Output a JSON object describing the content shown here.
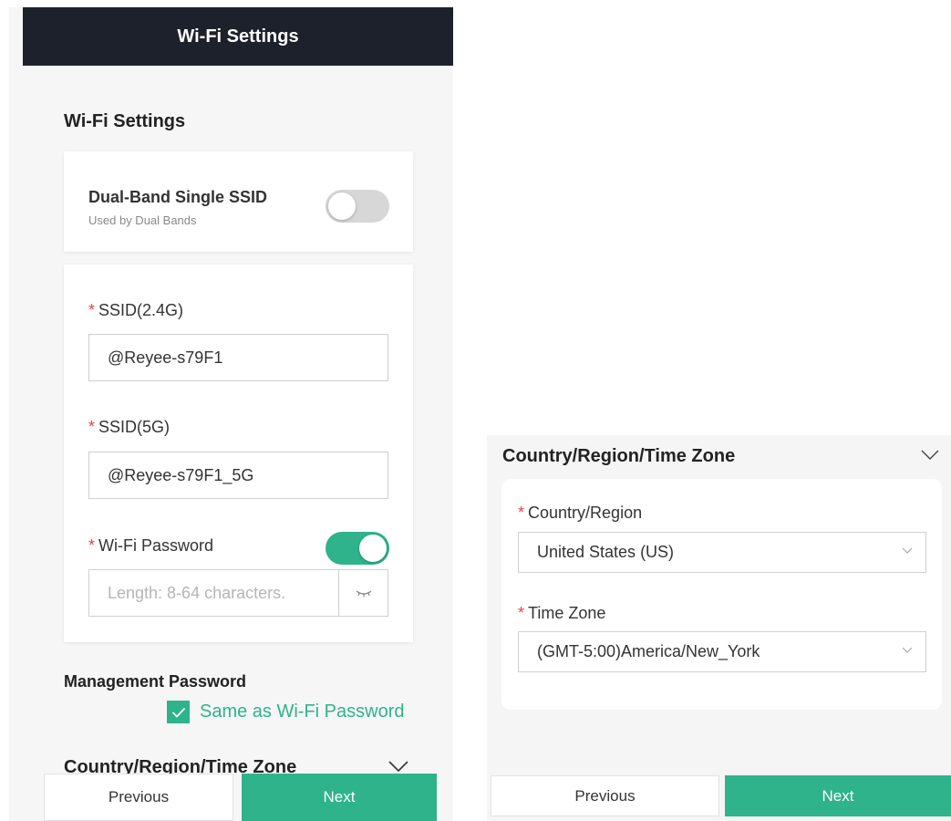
{
  "left": {
    "header_title": "Wi-Fi Settings",
    "section_title": "Wi-Fi Settings",
    "dual_band": {
      "label": "Dual-Band Single SSID",
      "sublabel": "Used by Dual Bands",
      "enabled": false
    },
    "ssid24": {
      "label": "SSID(2.4G)",
      "value": "@Reyee-s79F1"
    },
    "ssid5": {
      "label": "SSID(5G)",
      "value": "@Reyee-s79F1_5G"
    },
    "wifi_password": {
      "label": "Wi-Fi Password",
      "placeholder": "Length: 8-64 characters.",
      "enabled": true
    },
    "management": {
      "title": "Management Password",
      "checkbox_label": "Same as Wi-Fi Password",
      "checked": true
    },
    "country_section_title": "Country/Region/Time Zone",
    "prev_label": "Previous",
    "next_label": "Next"
  },
  "right": {
    "section_title": "Country/Region/Time Zone",
    "country": {
      "label": "Country/Region",
      "value": "United States (US)"
    },
    "timezone": {
      "label": "Time Zone",
      "value": "(GMT-5:00)America/New_York"
    },
    "prev_label": "Previous",
    "next_label": "Next"
  },
  "required_mark": "*",
  "colors": {
    "accent": "#2eb38b",
    "header_bg": "#1c212b",
    "required": "#e54545"
  }
}
